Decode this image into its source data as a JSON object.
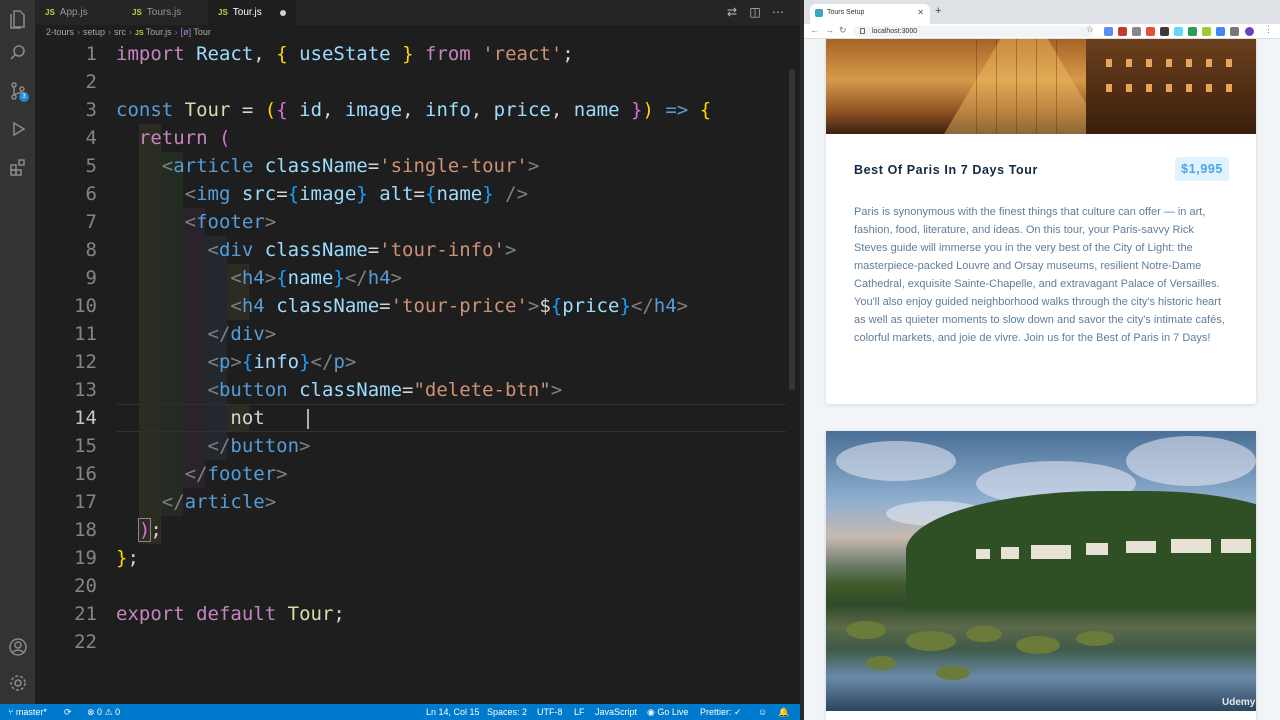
{
  "vscode": {
    "tabs": [
      {
        "label": "App.js",
        "icon": "JS"
      },
      {
        "label": "Tours.js",
        "icon": "JS"
      },
      {
        "label": "Tour.js",
        "icon": "JS",
        "active": true,
        "modified": true
      }
    ],
    "breadcrumb": [
      "2-tours",
      "setup",
      "src",
      "Tour.js",
      "Tour"
    ],
    "badges": {
      "source_control": "3"
    },
    "lines": [
      "1",
      "2",
      "3",
      "4",
      "5",
      "6",
      "7",
      "8",
      "9",
      "10",
      "11",
      "12",
      "13",
      "14",
      "15",
      "16",
      "17",
      "18",
      "19",
      "20",
      "21",
      "22"
    ],
    "status": {
      "branch": "master*",
      "errors": "0",
      "warnings": "0",
      "position": "Ln 14, Col 15",
      "spaces": "Spaces: 2",
      "encoding": "UTF-8",
      "eol": "LF",
      "language": "JavaScript",
      "golive": "Go Live",
      "prettier": "Prettier: ✓"
    },
    "code": {
      "l1": [
        "import",
        "React",
        ",",
        "{",
        "useState",
        "}",
        "from",
        "'react'",
        ";"
      ],
      "l3": [
        "const",
        "Tour",
        "=",
        "(",
        "{",
        "id",
        "image",
        "info",
        "price",
        "name",
        "}",
        ")",
        "=>",
        "{"
      ],
      "l4": [
        "return",
        "("
      ],
      "l5": [
        "article",
        "className",
        "'single-tour'"
      ],
      "l6": [
        "img",
        "src",
        "image",
        "alt",
        "name"
      ],
      "l7": [
        "footer"
      ],
      "l8": [
        "div",
        "className",
        "'tour-info'"
      ],
      "l9": [
        "h4",
        "name",
        "h4"
      ],
      "l10": [
        "h4",
        "className",
        "'tour-price'",
        "$",
        "price",
        "h4"
      ],
      "l11": [
        "div"
      ],
      "l12": [
        "p",
        "info",
        "p"
      ],
      "l13": [
        "button",
        "className",
        "\"delete-btn\""
      ],
      "l14": [
        "not "
      ],
      "l15": [
        "button"
      ],
      "l16": [
        "footer"
      ],
      "l17": [
        "article"
      ],
      "l18": [
        ")",
        ";"
      ],
      "l19": [
        "}",
        ";"
      ],
      "l21": [
        "export",
        "default",
        "Tour",
        ";"
      ]
    }
  },
  "browser": {
    "tab_title": "Tours Setup",
    "url": "localhost:3000",
    "tour": {
      "name": "Best Of Paris In 7 Days Tour",
      "price": "$1,995",
      "info": "Paris is synonymous with the finest things that culture can offer — in art, fashion, food, literature, and ideas. On this tour, your Paris-savvy Rick Steves guide will immerse you in the very best of the City of Light: the masterpiece-packed Louvre and Orsay museums, resilient Notre-Dame Cathedral, exquisite Sainte-Chapelle, and extravagant Palace of Versailles. You'll also enjoy guided neighborhood walks through the city's historic heart as well as quieter moments to slow down and savor the city's intimate cafés, colorful markets, and joie de vivre. Join us for the Best of Paris in 7 Days!"
    },
    "watermark": "Udemy"
  },
  "colors": {
    "status_bar": "#007acc",
    "price_text": "#49a6e9",
    "price_bg": "#e0f2fe",
    "title": "#102a42"
  }
}
